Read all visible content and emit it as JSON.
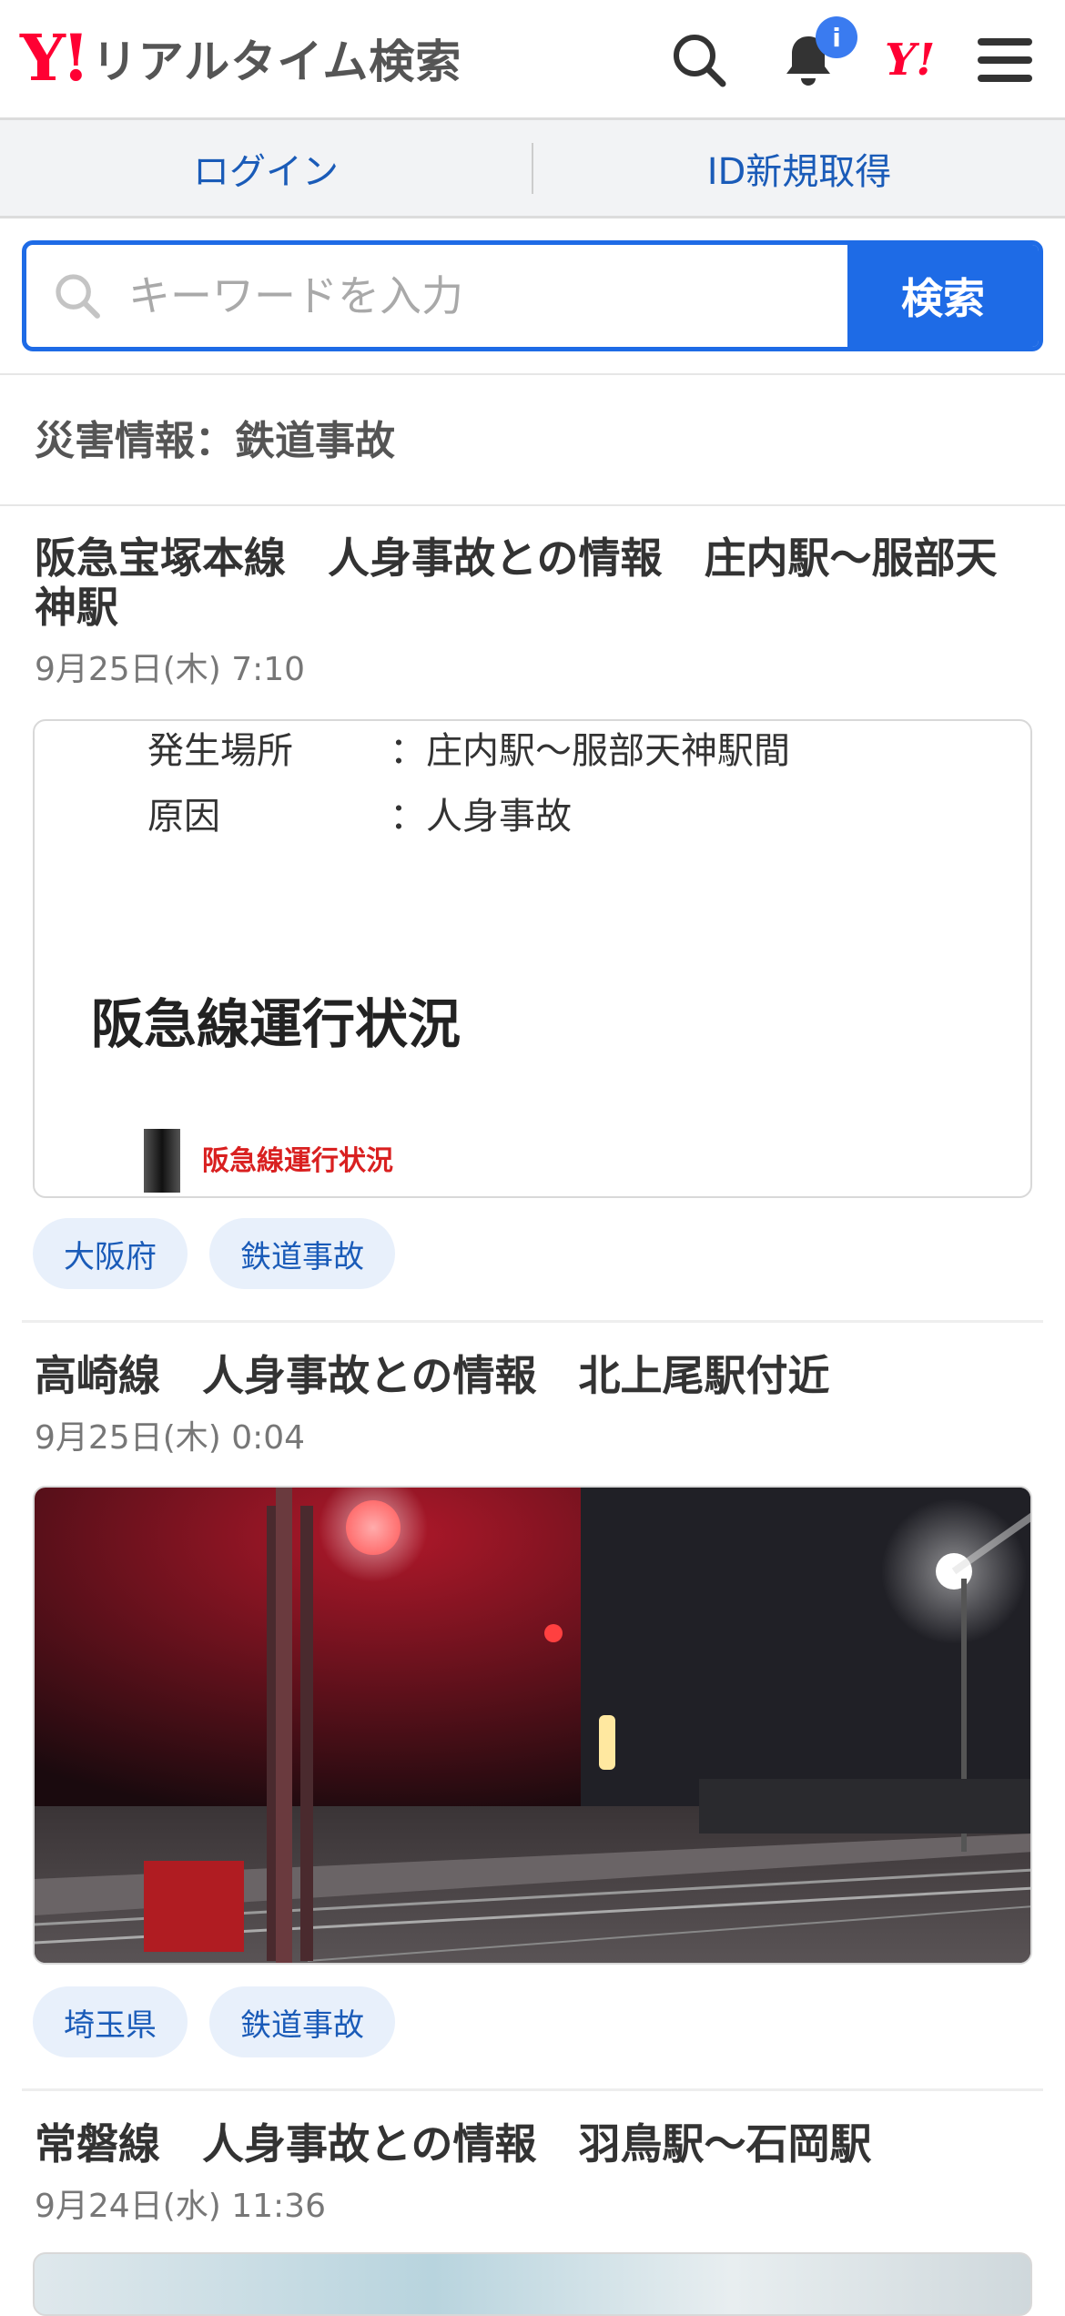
{
  "header": {
    "logo_mark": "Y!",
    "logo_text": "リアルタイム検索",
    "notification_badge": "i",
    "yahoo_japan_mark": "Y!"
  },
  "auth": {
    "login": "ログイン",
    "register": "ID新規取得"
  },
  "search": {
    "placeholder": "キーワードを入力",
    "button": "検索"
  },
  "section_title": "災害情報：鉄道事故",
  "articles": [
    {
      "title": "阪急宝塚本線　人身事故との情報　庄内駅〜服部天神駅",
      "date": "9月25日(木) 7:10",
      "image": {
        "line1_label": "発生場所",
        "line1_value": "：庄内駅〜服部天神駅間",
        "line2_label": "原因",
        "line2_value": "：人身事故",
        "heading": "阪急線運行状況",
        "caption": "阪急線運行状況"
      },
      "tags": [
        "大阪府",
        "鉄道事故"
      ]
    },
    {
      "title": "高崎線　人身事故との情報　北上尾駅付近",
      "date": "9月25日(木) 0:04",
      "tags": [
        "埼玉県",
        "鉄道事故"
      ]
    },
    {
      "title": "常磐線　人身事故との情報　羽鳥駅〜石岡駅",
      "date": "9月24日(水) 11:36"
    }
  ]
}
